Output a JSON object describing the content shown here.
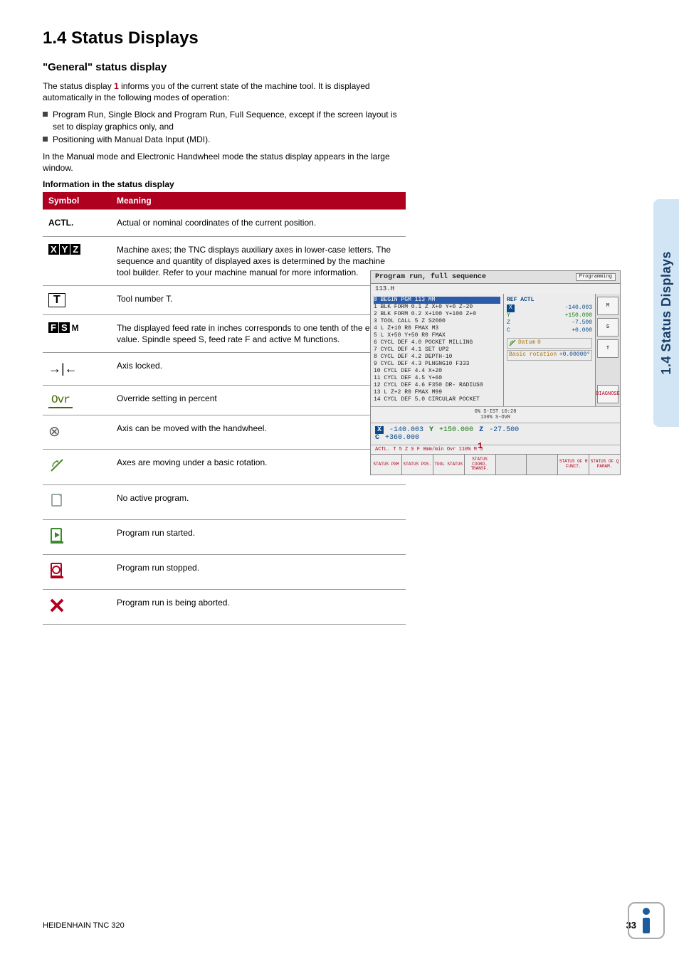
{
  "side_tab": "1.4 Status Displays",
  "section": {
    "number": "1.4",
    "title": "Status Displays",
    "full_title": "1.4  Status Displays"
  },
  "general": {
    "heading": "\"General\" status display",
    "intro_pre": "The status display ",
    "intro_ref": "1",
    "intro_post": " informs you of the current state of the machine tool. It is displayed automatically in the following modes of operation:",
    "bullets": [
      "Program Run, Single Block and Program Run, Full Sequence, except if the screen layout is set to display graphics only, and",
      "Positioning with Manual Data Input (MDI)."
    ],
    "manual_note": "In the Manual mode and Electronic Handwheel mode the status display appears in the large window.",
    "info_heading": "Information in the status display"
  },
  "table": {
    "headers": {
      "symbol": "Symbol",
      "meaning": "Meaning"
    },
    "rows": [
      {
        "sym_type": "actl",
        "sym_text": "ACTL.",
        "meaning": "Actual or nominal coordinates of the current position."
      },
      {
        "sym_type": "xyz",
        "sym_text": "X Y Z",
        "meaning": "Machine axes; the TNC displays auxiliary axes in lower-case letters. The sequence and quantity of displayed axes is determined by the machine tool builder. Refer to your machine manual for more information."
      },
      {
        "sym_type": "t",
        "sym_text": "T",
        "meaning": "Tool number T."
      },
      {
        "sym_type": "fsm",
        "sym_text": "F S M",
        "meaning": "The displayed feed rate in inches corresponds to one tenth of the effective value. Spindle speed S, feed rate F and active M functions."
      },
      {
        "sym_type": "lock",
        "sym_text": "⇥⇤",
        "meaning": "Axis locked."
      },
      {
        "sym_type": "ovr",
        "sym_text": "Ovr",
        "meaning": "Override setting in percent"
      },
      {
        "sym_type": "hand",
        "sym_text": "☸",
        "meaning": "Axis can be moved with the handwheel."
      },
      {
        "sym_type": "rot",
        "sym_text": "",
        "meaning": "Axes are moving under a basic rotation."
      },
      {
        "sym_type": "noprg",
        "sym_text": "",
        "meaning": "No active program."
      },
      {
        "sym_type": "run",
        "sym_text": "",
        "meaning": "Program run started."
      },
      {
        "sym_type": "stop",
        "sym_text": "",
        "meaning": "Program run stopped."
      },
      {
        "sym_type": "abort",
        "sym_text": "",
        "meaning": "Program run is being aborted."
      }
    ]
  },
  "screenshot": {
    "title": "Program run, full sequence",
    "title_right": "Programming",
    "file": "113.H",
    "prog": {
      "highlight": "0  BEGIN PGM 113 MM",
      "lines": [
        "1  BLK FORM 0.1 Z X+0 Y+0 Z-20",
        "2  BLK FORM 0.2  X+100  Y+100  Z+0",
        "3  TOOL CALL 5 Z S2000",
        "4  L  Z+10 R0 FMAX M3",
        "5  L  X+50  Y+50 R0 FMAX",
        "6  CYCL DEF 4.0 POCKET MILLING",
        "7  CYCL DEF 4.1 SET UP2",
        "8  CYCL DEF 4.2 DEPTH-10",
        "9  CYCL DEF 4.3 PLNGNG10 F333",
        "10 CYCL DEF 4.4 X+20",
        "11 CYCL DEF 4.5 Y+60",
        "12 CYCL DEF 4.6 F350 DR- RADIUS0",
        "13 L  Z+2 R0 FMAX M99",
        "14 CYCL DEF 5.0 CIRCULAR POCKET"
      ]
    },
    "ref": {
      "title": "REF ACTL",
      "X": "-140.003",
      "Y": "+150.000",
      "Z": "-7.500",
      "C": "+0.000",
      "datum_label": "Datum",
      "datum_value": "0",
      "rotation_label": "Basic rotation",
      "rotation_value": "+0.00000°"
    },
    "mid": {
      "l1": "0% S-IST 10:28",
      "l2": "130% S-OVR"
    },
    "coords": {
      "X": "-140.003",
      "Y": "+150.000",
      "Z": "-27.500",
      "C": "+360.000"
    },
    "status_line": "ACTL.        T  5  Z  S        F  0mm/min  Ovr 110%  M 5",
    "sidebar": [
      "M",
      "S",
      "T",
      "DIAGNOSE"
    ],
    "marker": "1",
    "softkeys": [
      "STATUS PGM",
      "STATUS POS.",
      "TOOL STATUS",
      "STATUS COORD. TRANSF.",
      "",
      "",
      "STATUS OF M FUNCT.",
      "STATUS OF Q PARAM."
    ]
  },
  "footer": {
    "left": "HEIDENHAIN TNC 320",
    "page": "33"
  }
}
